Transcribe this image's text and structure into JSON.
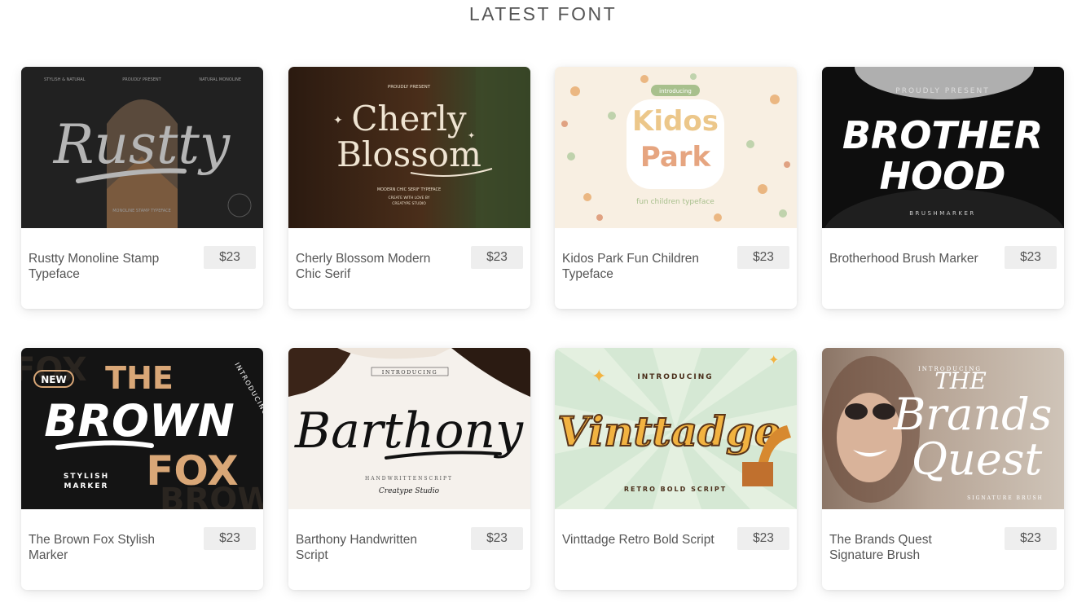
{
  "section": {
    "title": "LATEST FONT"
  },
  "cards": [
    {
      "title": "Rustty Monoline Stamp Typeface",
      "price": "$23",
      "art": {
        "line1": "Rustty",
        "tl": "STYLISH & NATURAL",
        "tc": "PROUDLY PRESENT",
        "tr": "NATURAL MONOLINE",
        "bottom": "MONOLINE STAMP TYPEFACE"
      }
    },
    {
      "title": "Cherly Blossom Modern Chic Serif",
      "price": "$23",
      "art": {
        "top": "PROUDLY PRESENT",
        "line1": "Cherly",
        "line2": "Blossom",
        "sub1": "MODERN CHIC SERIF TYPEFACE",
        "sub2": "CREATE WITH LOVE BY",
        "sub3": "CREATYPE STUDIO"
      }
    },
    {
      "title": "Kidos Park Fun Children Typeface",
      "price": "$23",
      "art": {
        "badge": "introducing",
        "line1": "Kidos",
        "line2": "Park",
        "sub": "fun children typeface"
      }
    },
    {
      "title": "Brotherhood Brush Marker",
      "price": "$23",
      "art": {
        "top": "PROUDLY PRESENT",
        "line1": "BROTHER",
        "line2": "HOOD",
        "sub": "BRUSHMARKER"
      }
    },
    {
      "title": "The Brown Fox Stylish Marker",
      "price": "$23",
      "art": {
        "badge": "NEW",
        "line0": "THE",
        "line1": "BROWN",
        "line2": "FOX",
        "side": "INTRODUCING",
        "sub1": "STYLISH",
        "sub2": "MARKER"
      }
    },
    {
      "title": "Barthony Handwritten Script",
      "price": "$23",
      "art": {
        "top": "INTRODUCING",
        "line1": "Barthony",
        "sub1": "HANDWRITTENSCRIPT",
        "sub2": "Creatype Studio"
      }
    },
    {
      "title": "Vinttadge Retro Bold Script",
      "price": "$23",
      "art": {
        "top": "INTRODUCING",
        "line1": "Vinttadge",
        "sub": "RETRO BOLD SCRIPT"
      }
    },
    {
      "title": "The Brands Quest Signature Brush",
      "price": "$23",
      "art": {
        "top": "INTRODUCING",
        "line0": "THE",
        "line1": "Brands",
        "line2": "Quest",
        "sub": "SIGNATURE BRUSH"
      }
    }
  ],
  "colors": {
    "title": "#555555",
    "price_bg": "#eeeeee",
    "card_bg": "#ffffff"
  }
}
